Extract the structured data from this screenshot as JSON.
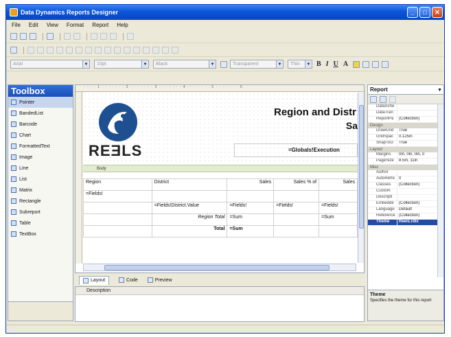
{
  "window": {
    "title": "Data Dynamics Reports Designer"
  },
  "menu": [
    "File",
    "Edit",
    "View",
    "Format",
    "Report",
    "Help"
  ],
  "format_toolbar": {
    "font": "Arial",
    "size": "10pt",
    "color": "Black",
    "style": "Transparent",
    "border": "Thin",
    "buttons": [
      "B",
      "I",
      "U",
      "A"
    ]
  },
  "toolbox": {
    "title": "Toolbox",
    "items": [
      "Pointer",
      "BandedList",
      "Barcode",
      "Chart",
      "FormattedText",
      "Image",
      "Line",
      "List",
      "Matrix",
      "Rectangle",
      "Subreport",
      "Table",
      "TextBox"
    ]
  },
  "designer": {
    "ruler_text": "· · · · 1 · · · · · · · 2 · · · · · · · 3 · · · · · · · 4 · · · · · · · 5 · · · · · · · 6",
    "logo_text": "REƎLS",
    "title": "Region and Distr",
    "subtitle": "Sa",
    "exec_field": "=Globals!Execution",
    "body_label": "Body",
    "table": {
      "header": [
        "Region",
        "District",
        "Sales",
        "Sales % of",
        "Sales"
      ],
      "rows": [
        [
          "=Fields!",
          "",
          "",
          "",
          ""
        ],
        [
          "",
          "=Fields!District.Value",
          "=Fields!",
          "=Fields!",
          "=Fields!"
        ],
        [
          "",
          "Region Total",
          "=Sum",
          "",
          "=Sum"
        ],
        [
          "",
          "Total",
          "=Sum",
          "",
          ""
        ]
      ]
    }
  },
  "tabs": [
    "Layout",
    "Code",
    "Preview"
  ],
  "description_panel": {
    "header": "Description"
  },
  "properties": {
    "object": "Report",
    "rows": [
      {
        "type": "prop",
        "name": "DataSche",
        "value": ""
      },
      {
        "type": "prop",
        "name": "DataTran",
        "value": ""
      },
      {
        "type": "prop",
        "name": "ReportPa",
        "value": "(Collection)"
      },
      {
        "type": "cat",
        "name": "Design"
      },
      {
        "type": "prop",
        "name": "DrawGrid",
        "value": "True"
      },
      {
        "type": "prop",
        "name": "GridSpac",
        "value": "0.125in"
      },
      {
        "type": "prop",
        "name": "SnapToG",
        "value": "True"
      },
      {
        "type": "cat",
        "name": "Layout"
      },
      {
        "type": "prop",
        "name": "Margins",
        "value": "0in, 0in, 0in, 0"
      },
      {
        "type": "prop",
        "name": "PageSize",
        "value": "8.5in, 11in"
      },
      {
        "type": "cat",
        "name": "Misc"
      },
      {
        "type": "prop",
        "name": "Author",
        "value": ""
      },
      {
        "type": "prop",
        "name": "AutoRefre",
        "value": "0"
      },
      {
        "type": "prop",
        "name": "Classes",
        "value": "(Collection)"
      },
      {
        "type": "prop",
        "name": "Custom",
        "value": ""
      },
      {
        "type": "prop",
        "name": "Descripti",
        "value": ""
      },
      {
        "type": "prop",
        "name": "Embedde",
        "value": "(Collection)"
      },
      {
        "type": "prop",
        "name": "Language",
        "value": "Default"
      },
      {
        "type": "prop",
        "name": "Reference",
        "value": "(Collection)"
      },
      {
        "type": "prop",
        "name": "Theme",
        "value": "Reels.rdlx",
        "highlight": true
      }
    ],
    "help_title": "Theme",
    "help_text": "Specifies the theme for this report"
  },
  "colors": {
    "titlebar": "#0b55d6",
    "toolbox_header": "#2f6fd8",
    "selection": "#244aa8",
    "logo_blue": "#1d4f91"
  }
}
